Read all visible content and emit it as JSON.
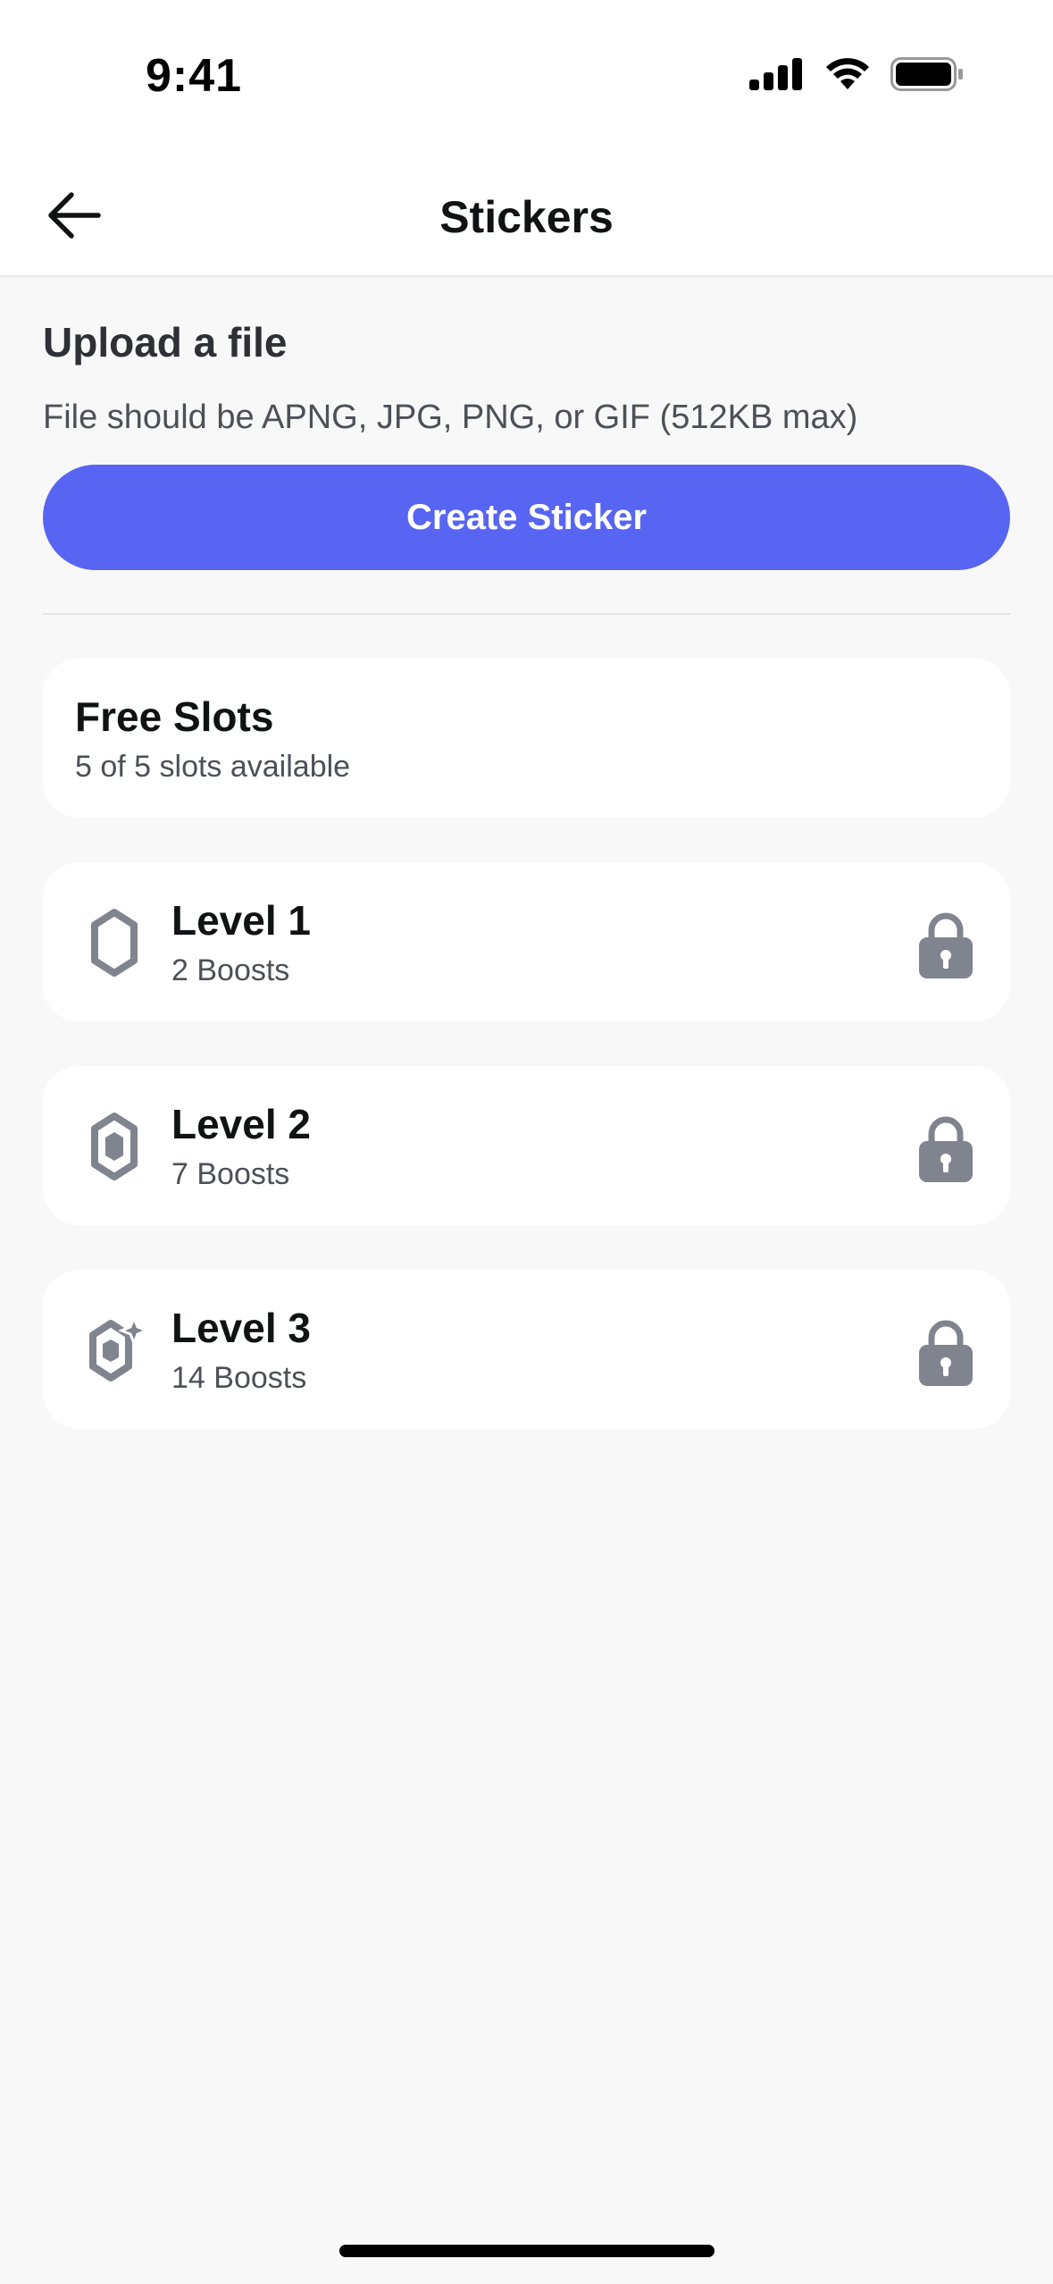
{
  "status_bar": {
    "time": "9:41",
    "icons": [
      "signal-icon",
      "wifi-icon",
      "battery-icon"
    ]
  },
  "header": {
    "title": "Stickers",
    "back_icon": "arrow-left-icon"
  },
  "upload": {
    "heading": "Upload a file",
    "description": "File should be APNG, JPG, PNG, or GIF (512KB max)",
    "button_label": "Create Sticker"
  },
  "free_slots": {
    "title": "Free Slots",
    "subtitle": "5 of 5 slots available"
  },
  "levels": [
    {
      "title": "Level 1",
      "subtitle": "2 Boosts",
      "icon": "boost-gem-level-1-icon",
      "locked": true
    },
    {
      "title": "Level 2",
      "subtitle": "7 Boosts",
      "icon": "boost-gem-level-2-icon",
      "locked": true
    },
    {
      "title": "Level 3",
      "subtitle": "14 Boosts",
      "icon": "boost-gem-level-3-icon",
      "locked": true
    }
  ],
  "colors": {
    "accent": "#5865f2",
    "icon_gray": "#80848e",
    "background": "#f8f8f8",
    "card": "#ffffff"
  }
}
